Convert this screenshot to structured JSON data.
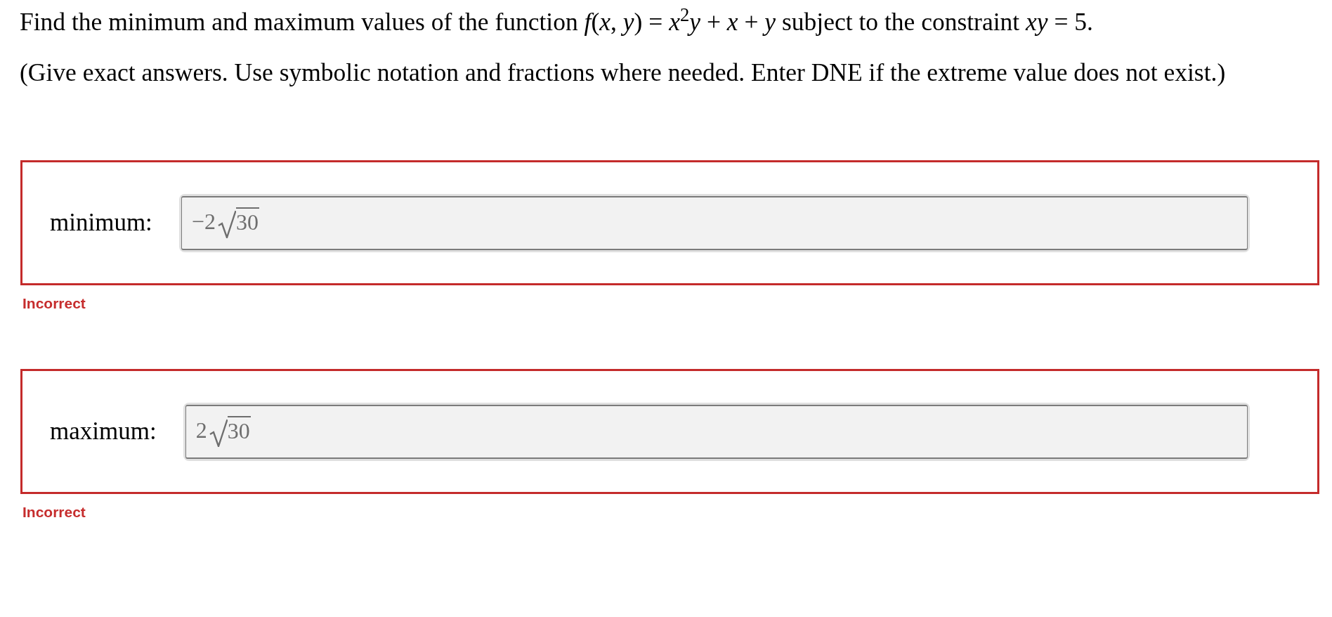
{
  "question": {
    "text": "Find the minimum and maximum values of the function *f*(*x*, *y*) = *x*$^{2}$*y* + *x* + *y* subject to the constraint *xy* = 5.",
    "instructions": "(Give exact answers. Use symbolic notation and fractions where needed. Enter DNE if the extreme value does not exist.)"
  },
  "answers": [
    {
      "label": "minimum:",
      "coefficient": "−2",
      "radicand": "30",
      "disabled": true,
      "correct": false,
      "feedback": "Incorrect"
    },
    {
      "label": "maximum:",
      "coefficient": "2",
      "radicand": "30",
      "disabled": true,
      "correct": false,
      "feedback": "Incorrect"
    }
  ]
}
